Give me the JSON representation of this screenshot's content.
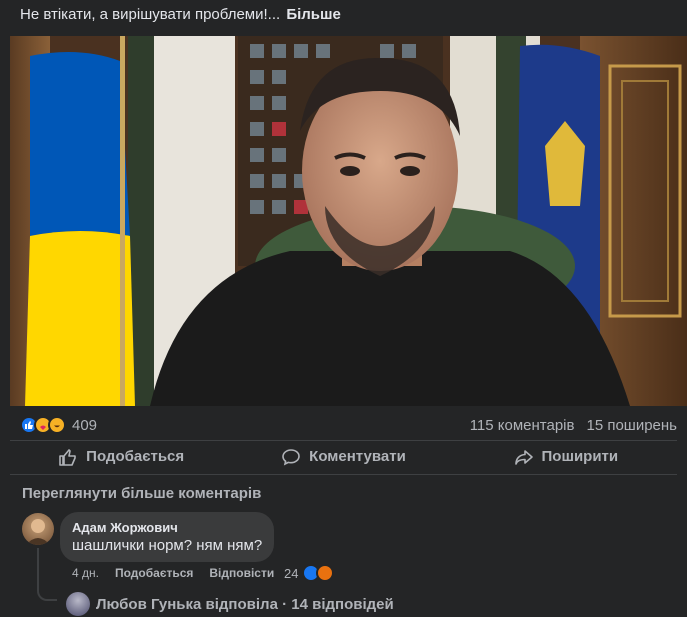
{
  "post": {
    "text": "Не втікати, а вирішувати проблеми!...",
    "more_label": "Більше"
  },
  "stats": {
    "reaction_count": "409",
    "comments": "115 коментарів",
    "shares": "15 поширень"
  },
  "actions": {
    "like": "Подобається",
    "comment": "Коментувати",
    "share": "Поширити"
  },
  "view_more": "Переглянути більше коментарів",
  "comment": {
    "author": "Адам Жоржович",
    "text": "шашлички норм? ням ням?",
    "time": "4 дн.",
    "like_label": "Подобається",
    "reply_label": "Відповісти",
    "reaction_count": "24"
  },
  "reply_summary": "Любов Гунька відповіла · 14 відповідей",
  "colors": {
    "background": "#242526",
    "like_blue": "#1877f2",
    "flag_blue": "#0057b7",
    "flag_yellow": "#ffd700"
  }
}
